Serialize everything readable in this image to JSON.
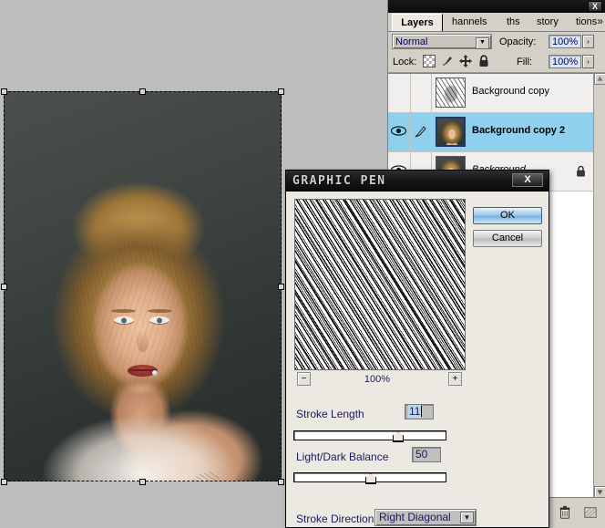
{
  "app": {
    "background_color": "#bdbdbd"
  },
  "canvas": {
    "name": "photo-canvas",
    "selection_active": true,
    "handles": 8
  },
  "layers_palette": {
    "close_label": "X",
    "tabs": [
      {
        "label": "Layers",
        "active": true
      },
      {
        "label": "hannels",
        "active": false
      },
      {
        "label": "ths",
        "active": false
      },
      {
        "label": "story",
        "active": false
      },
      {
        "label": "tions",
        "active": false
      }
    ],
    "overflow_label": "»",
    "blend_mode": "Normal",
    "blend_arrow": "▼",
    "opacity_label": "Opacity:",
    "opacity_value": "100%",
    "opacity_spin": "›",
    "lock_label": "Lock:",
    "lock_icons": [
      "transparency-lock-icon",
      "pixels-lock-icon",
      "position-lock-icon",
      "all-lock-icon"
    ],
    "fill_label": "Fill:",
    "fill_value": "100%",
    "fill_spin": "›",
    "layers": [
      {
        "name": "Background copy",
        "visible": false,
        "selected": false,
        "locked": false,
        "thumb": "sketch",
        "style": "normal"
      },
      {
        "name": "Background copy 2",
        "visible": true,
        "selected": true,
        "locked": false,
        "thumb": "portrait",
        "style": "bold"
      },
      {
        "name": "Background",
        "visible": true,
        "selected": false,
        "locked": true,
        "thumb": "portrait",
        "style": "italic"
      }
    ],
    "scroll_up": "▲",
    "scroll_down": "▼",
    "footer_icons": [
      "trash-icon",
      "new-layer-icon"
    ]
  },
  "graphic_pen_dialog": {
    "title": "GRAPHIC PEN",
    "close_label": "X",
    "ok_label": "OK",
    "cancel_label": "Cancel",
    "zoom_out_label": "−",
    "zoom_in_label": "+",
    "zoom_level": "100%",
    "stroke_length": {
      "label": "Stroke Length",
      "value": "11",
      "slider_percent": 68
    },
    "light_dark_balance": {
      "label": "Light/Dark Balance",
      "value": "50",
      "slider_percent": 50
    },
    "stroke_direction": {
      "label": "Stroke Direction:",
      "value": "Right Diagonal",
      "arrow": "▼"
    }
  }
}
